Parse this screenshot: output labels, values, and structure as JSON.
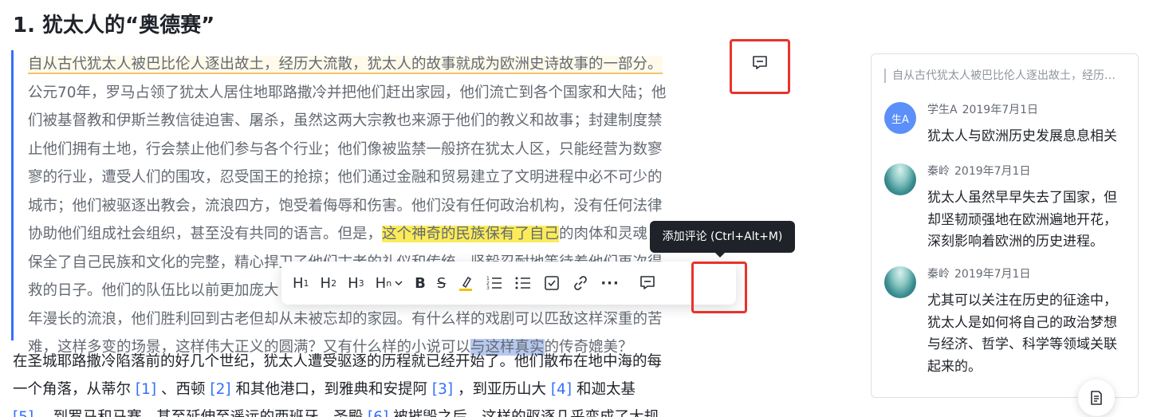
{
  "heading": "1. 犹太人的“奥德赛”",
  "quote": {
    "line0": "自从古代犹太人被巴比伦人逐出故土，经历大流散，犹太人的故事就成为欧洲史诗故事的一部分。",
    "line1": "公元70年，罗马占领了犹太人居住地耶路撒冷并把他们赶出家园，他们流亡到各个国家和大陆；他",
    "line2": "们被基督教和伊斯兰教信徒迫害、屠杀，虽然这两大宗教也来源于他们的教义和故事；封建制度禁",
    "line3": "止他们拥有土地，行会禁止他们参与各个行业；他们像被监禁一般挤在犹太人区，只能经营为数寥",
    "line4": "寥的行业，遭受人们的围攻，忍受国王的抢掠；他们通过金融和贸易建立了文明进程中必不可少的",
    "line5": "城市；他们被驱逐出教会，流浪四方，饱受着侮辱和伤害。他们没有任何政治机构，没有任何法律",
    "line6a": "协助他们组成社会组织，甚至没有共同的语言。但是，",
    "line6hl": "这个神奇的民族保有了自己",
    "line6b": "的肉体和灵魂，",
    "line7": "保全了自己民族和文化的完整，精心捍卫了他们古老的礼仪和传统，坚毅忍耐地等待着他们再次得",
    "line8": "救的日子。他们的队伍比以前更加庞大",
    "line9": "年漫长的流浪，他们胜利回到古老但却从未被忘却的家园。有什么样的戏剧可以匹敌这样深重的苦",
    "line10a": "难，这样多变的场景，这样伟大正义的圆满？又有什么样的小说可以",
    "line10hl": "与这样真实",
    "line10b": "的传奇媲美？"
  },
  "body": {
    "line0": "在圣城耶路撒冷陷落前的好几个世纪，犹太人遭受驱逐的历程就已经开始了。他们散布在地中海的每",
    "line1a": "一个角落，从蒂尔 ",
    "ref1": "[1]",
    "line1b": " 、西顿 ",
    "ref2": "[2]",
    "line1c": " 和其他港口，到雅典和安提阿 ",
    "ref3": "[3]",
    "line1d": " ，到亚历山大 ",
    "ref4": "[4]",
    "line1e": " 和迦太基",
    "ref5": "[5]",
    "line2a": " ，到罗马和马赛，甚至延伸至遥远的西班牙。圣殿 ",
    "ref6": "[6]",
    "line2b": " 被摧毁之后，这样的驱逐几乎变成了大规"
  },
  "toolbar": {
    "h1": "H",
    "h2": "H",
    "h3": "H",
    "hn": "H",
    "s1": "1",
    "s2": "2",
    "s3": "3",
    "sn": "n",
    "bold": "B",
    "strike": "S",
    "more": "···"
  },
  "tooltip": "添加评论 (Ctrl+Alt+M)",
  "panel": {
    "quote_ref": "自从古代犹太人被巴比伦人逐出故土，经历大流散，犹太人的故事就成为欧洲史诗故事的一部分。",
    "comments": [
      {
        "avatar_text": "生A",
        "author": "学生A",
        "date": "2019年7月1日",
        "lines": [
          "犹太人与欧洲历史发展息息相关"
        ]
      },
      {
        "author": "秦岭",
        "date": "2019年7月1日",
        "lines": [
          "犹太人虽然早早失去了国家，但",
          "却坚韧顽强地在欧洲遍地开花，",
          "深刻影响着欧洲的历史进程。"
        ]
      },
      {
        "author": "秦岭",
        "date": "2019年7月1日",
        "lines": [
          "尤其可以关注在历史的征途中，",
          "犹太人是如何将自己的政治梦想",
          "与经济、哲学、科学等领域关联",
          "起来的。"
        ]
      }
    ]
  },
  "icons": {
    "comment_top": "comment-icon",
    "comment_toolbar": "comment-icon",
    "float": "outline-icon"
  },
  "colors": {
    "accent": "#3370ff",
    "highlight_yellow": "#fbeb5a",
    "highlight_blue": "#b7c9ef",
    "annotation_red": "#e8332b"
  }
}
